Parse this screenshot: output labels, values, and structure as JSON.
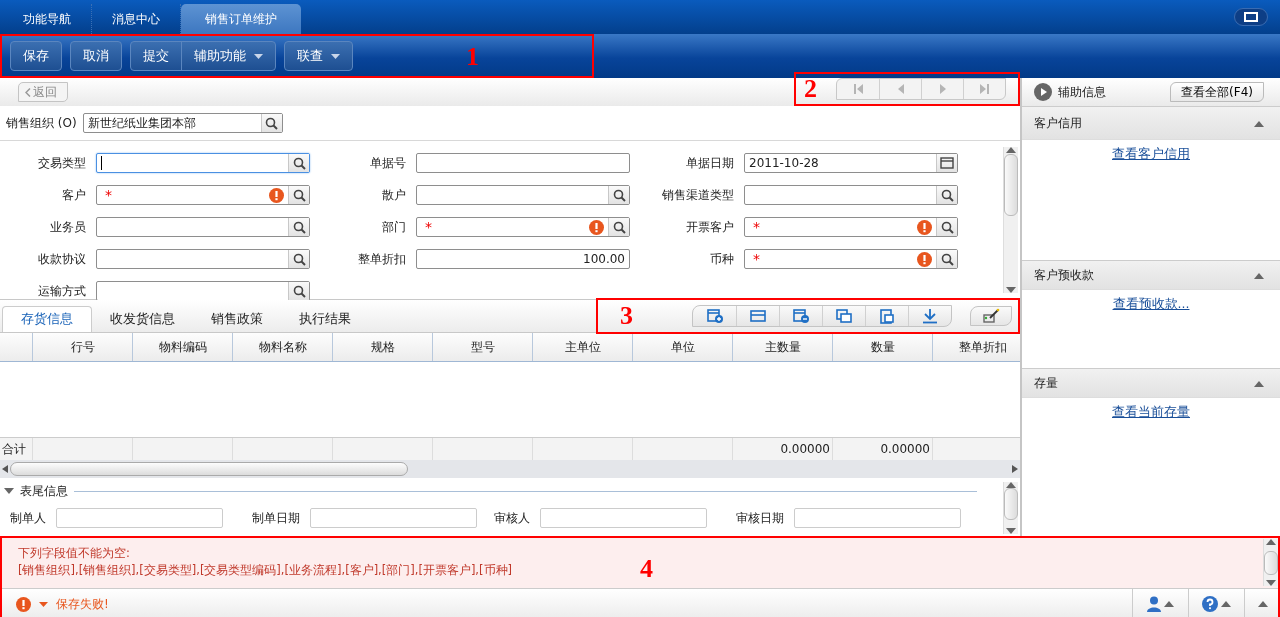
{
  "top_tabs": [
    {
      "label": "功能导航",
      "selected": false
    },
    {
      "label": "消息中心",
      "selected": false
    },
    {
      "label": "销售订单维护",
      "selected": true
    }
  ],
  "toolbar": {
    "annotation": "1",
    "groups": [
      {
        "items": [
          {
            "label": "保存",
            "dropdown": false
          }
        ]
      },
      {
        "items": [
          {
            "label": "取消",
            "dropdown": false
          }
        ]
      },
      {
        "items": [
          {
            "label": "提交",
            "dropdown": false
          },
          {
            "label": "辅助功能",
            "dropdown": true
          }
        ]
      },
      {
        "items": [
          {
            "label": "联查",
            "dropdown": true
          }
        ]
      }
    ]
  },
  "nav": {
    "back": "返回",
    "pager_annotation": "2"
  },
  "org": {
    "label": "销售组织 (O)",
    "value": "新世纪纸业集团本部"
  },
  "form": {
    "required_mark": "*",
    "fields": [
      {
        "label": "交易类型",
        "kind": "lookup",
        "required": false,
        "focused": true
      },
      {
        "label": "单据号",
        "kind": "text",
        "required": false,
        "focused": false
      },
      {
        "label": "单据日期",
        "kind": "date",
        "value": "2011-10-28",
        "required": false,
        "focused": false
      },
      {
        "label": "客户",
        "kind": "lookup",
        "required": true,
        "focused": false
      },
      {
        "label": "散户",
        "kind": "lookup",
        "required": false,
        "focused": false
      },
      {
        "label": "销售渠道类型",
        "kind": "lookup",
        "required": false,
        "focused": false
      },
      {
        "label": "业务员",
        "kind": "lookup",
        "required": false,
        "focused": false
      },
      {
        "label": "部门",
        "kind": "lookup",
        "required": true,
        "focused": false
      },
      {
        "label": "开票客户",
        "kind": "lookup",
        "required": true,
        "focused": false
      },
      {
        "label": "收款协议",
        "kind": "lookup",
        "required": false,
        "focused": false
      },
      {
        "label": "整单折扣",
        "kind": "number",
        "value": "100.00",
        "required": false,
        "focused": false
      },
      {
        "label": "币种",
        "kind": "lookup",
        "required": true,
        "focused": false
      },
      {
        "label": "运输方式",
        "kind": "lookup",
        "required": false,
        "focused": false
      }
    ]
  },
  "detail_tabs": [
    {
      "label": "存货信息",
      "selected": true
    },
    {
      "label": "收发货信息",
      "selected": false
    },
    {
      "label": "销售政策",
      "selected": false
    },
    {
      "label": "执行结果",
      "selected": false
    }
  ],
  "grid_toolbar": {
    "annotation": "3"
  },
  "table": {
    "total_label": "合计",
    "columns": [
      {
        "title": "行号"
      },
      {
        "title": "物料编码"
      },
      {
        "title": "物料名称"
      },
      {
        "title": "规格"
      },
      {
        "title": "型号"
      },
      {
        "title": "主单位"
      },
      {
        "title": "单位"
      },
      {
        "title": "主数量",
        "total": "0.00000"
      },
      {
        "title": "数量",
        "total": "0.00000"
      },
      {
        "title": "整单折扣"
      }
    ]
  },
  "footer": {
    "title": "表尾信息",
    "expanded": true,
    "fields": [
      {
        "label": "制单人"
      },
      {
        "label": "制单日期"
      },
      {
        "label": "审核人"
      },
      {
        "label": "审核日期"
      }
    ]
  },
  "message": {
    "annotation": "4",
    "lines": [
      "下列字段值不能为空:",
      "[销售组织],[销售组织],[交易类型],[交易类型编码],[业务流程],[客户],[部门],[开票客户],[币种]"
    ]
  },
  "status": {
    "text": "保存失败!"
  },
  "aux_panel": {
    "title": "辅助信息",
    "view_all": "查看全部(F4)",
    "sections": [
      {
        "title": "客户信用",
        "link": "查看客户信用",
        "expanded": true
      },
      {
        "title": "客户预收款",
        "link": "查看预收款...",
        "expanded": true
      },
      {
        "title": "存量",
        "link": "查看当前存量",
        "expanded": true
      }
    ]
  }
}
